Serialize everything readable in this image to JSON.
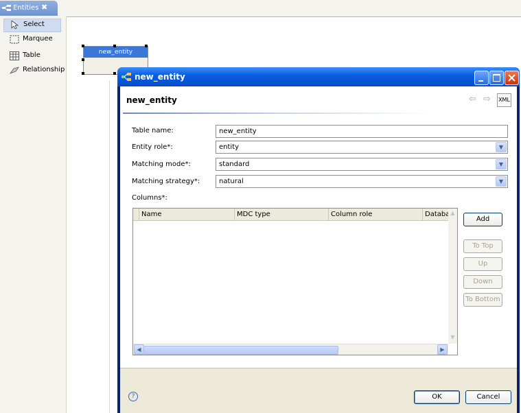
{
  "editor_tab": {
    "label": "Entities",
    "close_glyph": "✖"
  },
  "palette": {
    "items": [
      {
        "label": "Select",
        "icon": "pointer-icon"
      },
      {
        "label": "Marquee",
        "icon": "marquee-icon"
      },
      {
        "label": "Table",
        "icon": "table-icon"
      },
      {
        "label": "Relationship",
        "icon": "relationship-icon"
      }
    ]
  },
  "canvas": {
    "entity_name": "new_entity"
  },
  "dialog": {
    "title": "new_entity",
    "header_title": "new_entity",
    "xml_label": "XML",
    "fields": {
      "table_name_label": "Table name:",
      "table_name_value": "new_entity",
      "entity_role_label": "Entity role*:",
      "entity_role_value": "entity",
      "matching_mode_label": "Matching mode*:",
      "matching_mode_value": "standard",
      "matching_strategy_label": "Matching strategy*:",
      "matching_strategy_value": "natural",
      "columns_label": "Columns*:"
    },
    "table": {
      "columns": [
        "Name",
        "MDC type",
        "Column role",
        "Databa"
      ]
    },
    "side_buttons": {
      "add": "Add",
      "to_top": "To Top",
      "up": "Up",
      "down": "Down",
      "to_bottom": "To Bottom"
    },
    "footer": {
      "ok": "OK",
      "cancel": "Cancel",
      "help_glyph": "?"
    }
  },
  "colors": {
    "titlebar": "#0553d4",
    "selection": "#3a77d6",
    "dialog_bg": "#ece9d8"
  }
}
